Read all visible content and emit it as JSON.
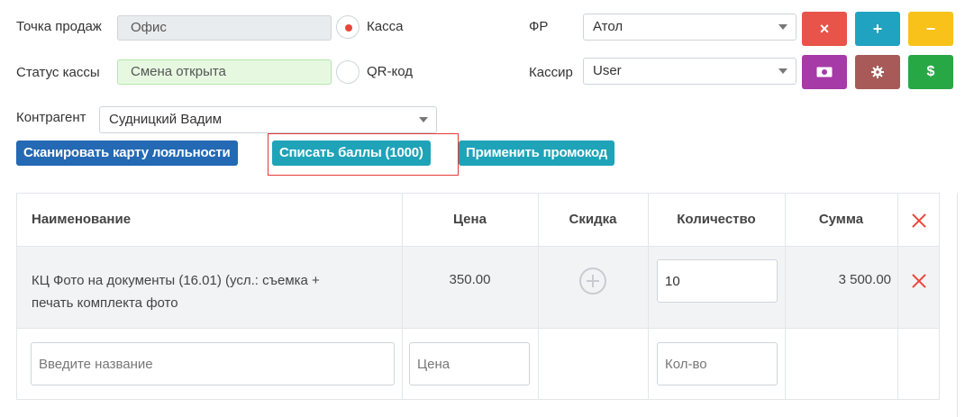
{
  "form": {
    "point_label": "Точка продаж",
    "point_value": "Офис",
    "status_label": "Статус кассы",
    "status_value": "Смена открыта",
    "radio_kassa": "Касса",
    "radio_qr": "QR-код",
    "fr_label": "ФР",
    "fr_value": "Атол",
    "cashier_label": "Кассир",
    "cashier_value": "User",
    "contractor_label": "Контрагент",
    "contractor_value": "Судницкий Вадим"
  },
  "icon_buttons": {
    "close": {
      "icon": "×",
      "color": "#e8534a"
    },
    "add": {
      "icon": "+",
      "color": "#1fa3c0"
    },
    "minus": {
      "icon": "−",
      "color": "#f8c21a"
    },
    "money": {
      "icon": "money-icon",
      "color": "#a63aa6"
    },
    "settings": {
      "icon": "gear-icon",
      "color": "#a85a58"
    },
    "dollar": {
      "icon": "$",
      "color": "#28a745"
    }
  },
  "actions": {
    "scan_card": "Сканировать карту лояльности",
    "write_off_points": "Списать баллы (1000)",
    "apply_promo": "Применить промокод"
  },
  "table": {
    "headers": [
      "Наименование",
      "Цена",
      "Скидка",
      "Количество",
      "Сумма"
    ],
    "rows": [
      {
        "name_line1": "КЦ Фото на документы (16.01) (усл.: съемка +",
        "name_line2": "печать комплекта фото",
        "price": "350.00",
        "quantity": "10",
        "sum": "3 500.00"
      }
    ],
    "new_row": {
      "name_placeholder": "Введите название",
      "price_placeholder": "Цена",
      "qty_placeholder": "Кол-во"
    }
  }
}
